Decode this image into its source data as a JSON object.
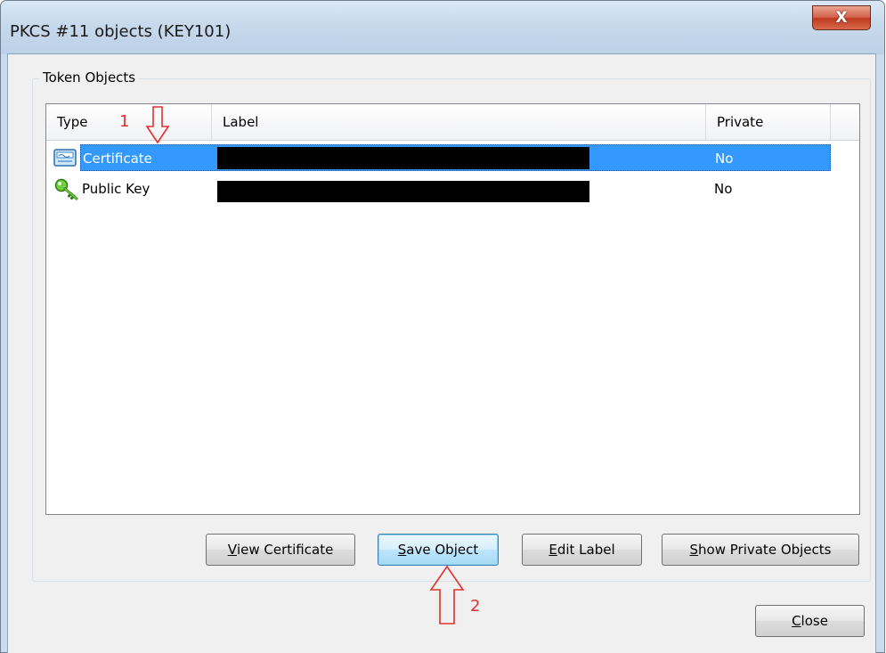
{
  "window": {
    "title": "PKCS #11 objects (KEY101)",
    "close_glyph": "X"
  },
  "group": {
    "label": "Token Objects"
  },
  "table": {
    "columns": [
      "Type",
      "Label",
      "Private"
    ],
    "rows": [
      {
        "type": "Certificate",
        "label": "",
        "private": "No",
        "icon": "certificate-icon",
        "selected": true
      },
      {
        "type": "Public Key",
        "label": "",
        "private": "No",
        "icon": "key-icon",
        "selected": false
      }
    ]
  },
  "buttons": {
    "view_certificate": {
      "accel": "V",
      "rest": "iew Certificate"
    },
    "save_object": {
      "accel": "S",
      "rest": "ave Object"
    },
    "edit_label": {
      "accel": "E",
      "rest": "dit Label"
    },
    "show_private": {
      "accel": "S",
      "rest": "how Private Objects"
    },
    "close": {
      "accel": "C",
      "rest": "lose"
    }
  },
  "annotations": {
    "step1": "1",
    "step2": "2"
  },
  "colors": {
    "selection": "#3399ff",
    "annotation": "#e0322e"
  }
}
